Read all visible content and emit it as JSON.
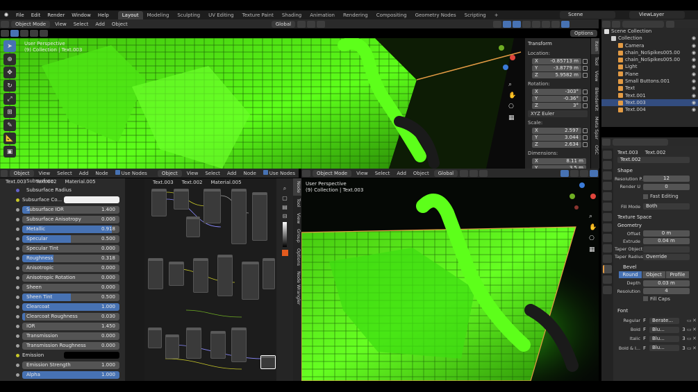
{
  "menubar": {
    "menus": [
      "File",
      "Edit",
      "Render",
      "Window",
      "Help"
    ],
    "workspaces": [
      "Layout",
      "Modeling",
      "Sculpting",
      "UV Editing",
      "Texture Paint",
      "Shading",
      "Animation",
      "Rendering",
      "Compositing",
      "Geometry Nodes",
      "Scripting"
    ],
    "active_workspace": "Layout",
    "add_tab": "+",
    "scene": "Scene",
    "view_layer": "ViewLayer"
  },
  "viewport_top": {
    "mode": "Object Mode",
    "menus": [
      "View",
      "Select",
      "Add",
      "Object"
    ],
    "orientation": "Global",
    "options": "Options",
    "overlay_title": "User Perspective",
    "overlay_sub": "(9) Collection | Text.003"
  },
  "npanel": {
    "title": "Transform",
    "location_label": "Location:",
    "location": [
      {
        "axis": "X",
        "value": "-0.85713 m"
      },
      {
        "axis": "Y",
        "value": "-3.8779 m"
      },
      {
        "axis": "Z",
        "value": "5.9582 m"
      }
    ],
    "rotation_label": "Rotation:",
    "rotation": [
      {
        "axis": "X",
        "value": "-303°"
      },
      {
        "axis": "Y",
        "value": "-0.36°"
      },
      {
        "axis": "Z",
        "value": "3°"
      }
    ],
    "euler": "XYZ Euler",
    "scale_label": "Scale:",
    "scale": [
      {
        "axis": "X",
        "value": "2.597"
      },
      {
        "axis": "Y",
        "value": "3.044"
      },
      {
        "axis": "Z",
        "value": "2.634"
      }
    ],
    "dimensions_label": "Dimensions:",
    "dimensions": [
      {
        "axis": "X",
        "value": "8.11 m"
      },
      {
        "axis": "Y",
        "value": "3.5 m"
      }
    ],
    "tabs": [
      "Item",
      "Tool",
      "View",
      "BlenderKit",
      "Meta Spar",
      "OSC"
    ]
  },
  "outliner": {
    "root": "Scene Collection",
    "items": [
      {
        "name": "Collection",
        "color": "#cfcfcf",
        "selected": false,
        "indent": 1
      },
      {
        "name": "Camera",
        "color": "#e39b44",
        "selected": false,
        "indent": 2
      },
      {
        "name": "chain_NoSpikes005.00",
        "color": "#e39b44",
        "selected": false,
        "indent": 2
      },
      {
        "name": "chain_NoSpikes005.00",
        "color": "#e39b44",
        "selected": false,
        "indent": 2
      },
      {
        "name": "Light",
        "color": "#e39b44",
        "selected": false,
        "indent": 2
      },
      {
        "name": "Plane",
        "color": "#e39b44",
        "selected": false,
        "indent": 2
      },
      {
        "name": "Small Buttons.001",
        "color": "#e39b44",
        "selected": false,
        "indent": 2
      },
      {
        "name": "Text",
        "color": "#e39b44",
        "selected": false,
        "indent": 2
      },
      {
        "name": "Text.001",
        "color": "#e39b44",
        "selected": false,
        "indent": 2
      },
      {
        "name": "Text.003",
        "color": "#e39b44",
        "selected": true,
        "indent": 2
      },
      {
        "name": "Text.004",
        "color": "#e39b44",
        "selected": false,
        "indent": 2
      }
    ]
  },
  "props": {
    "crumb_a": "Text.003",
    "crumb_b": "Text.002",
    "datablock": "Text.002",
    "shape": "Shape",
    "resolution_preview_label": "Resolution P...",
    "resolution_preview": "12",
    "render_u_label": "Render U",
    "render_u": "0",
    "fast_editing": "Fast Editing",
    "fill_mode_label": "Fill Mode",
    "fill_mode": "Both",
    "texture_space": "Texture Space",
    "geometry": "Geometry",
    "offset_label": "Offset",
    "offset": "0 m",
    "extrude_label": "Extrude",
    "extrude": "0.04 m",
    "taper_object_label": "Taper Object",
    "taper_radius_label": "Taper Radius",
    "taper_radius": "Override",
    "bevel": "Bevel",
    "bevel_modes": [
      "Round",
      "Object",
      "Profile"
    ],
    "depth_label": "Depth",
    "depth": "0.03 m",
    "resolution_label": "Resolution",
    "resolution": "4",
    "fill_caps": "Fill Caps",
    "font": "Font",
    "fonts": [
      {
        "label": "Regular",
        "name": "Berate...",
        "users": ""
      },
      {
        "label": "Bold",
        "name": "Blu...",
        "users": "3"
      },
      {
        "label": "Italic",
        "name": "Blu...",
        "users": "3"
      },
      {
        "label": "Bold & I...",
        "name": "Blu...",
        "users": "3"
      }
    ]
  },
  "shader_header": {
    "mode": "Object",
    "menus": [
      "View",
      "Select",
      "Add",
      "Node"
    ],
    "use_nodes": "Use Nodes",
    "crumbs": [
      "Text.003",
      "Text.002",
      "Material.005"
    ]
  },
  "material": {
    "top_label": "Subsurface",
    "rows": [
      {
        "label": "Subsurface Radius",
        "value": "",
        "fill": 0,
        "kind": "plain",
        "dot": "b"
      },
      {
        "label": "Subsurface Co...",
        "value": "",
        "fill": 0,
        "kind": "color",
        "dot": "y"
      },
      {
        "label": "Subsurface IOR",
        "value": "1.400",
        "fill": 0.08,
        "kind": "bar",
        "dot": "g"
      },
      {
        "label": "Subsurface Anisotropy",
        "value": "0.000",
        "fill": 0,
        "kind": "bar",
        "dot": "g"
      },
      {
        "label": "Metallic",
        "value": "0.918",
        "fill": 0.918,
        "kind": "bar",
        "dot": "g"
      },
      {
        "label": "Specular",
        "value": "0.500",
        "fill": 0.5,
        "kind": "bar",
        "dot": "g"
      },
      {
        "label": "Specular Tint",
        "value": "0.000",
        "fill": 0,
        "kind": "bar",
        "dot": "g"
      },
      {
        "label": "Roughness",
        "value": "0.318",
        "fill": 0.318,
        "kind": "bar",
        "dot": "g"
      },
      {
        "label": "Anisotropic",
        "value": "0.000",
        "fill": 0,
        "kind": "bar",
        "dot": "g"
      },
      {
        "label": "Anisotropic Rotation",
        "value": "0.000",
        "fill": 0,
        "kind": "bar",
        "dot": "g"
      },
      {
        "label": "Sheen",
        "value": "0.000",
        "fill": 0,
        "kind": "bar",
        "dot": "g"
      },
      {
        "label": "Sheen Tint",
        "value": "0.500",
        "fill": 0.5,
        "kind": "bar",
        "dot": "g"
      },
      {
        "label": "Clearcoat",
        "value": "1.000",
        "fill": 1,
        "kind": "bar",
        "dot": "g"
      },
      {
        "label": "Clearcoat Roughness",
        "value": "0.030",
        "fill": 0.03,
        "kind": "bar",
        "dot": "g"
      },
      {
        "label": "IOR",
        "value": "1.450",
        "fill": 0,
        "kind": "bar",
        "dot": "g"
      },
      {
        "label": "Transmission",
        "value": "0.000",
        "fill": 0,
        "kind": "bar",
        "dot": "g"
      },
      {
        "label": "Transmission Roughness",
        "value": "0.000",
        "fill": 0,
        "kind": "bar",
        "dot": "g"
      },
      {
        "label": "Emission",
        "value": "",
        "fill": 0,
        "kind": "dark",
        "dot": "y"
      },
      {
        "label": "Emission Strength",
        "value": "1.000",
        "fill": 0,
        "kind": "bar",
        "dot": "g"
      },
      {
        "label": "Alpha",
        "value": "1.000",
        "fill": 1,
        "kind": "bar",
        "dot": "g"
      }
    ]
  },
  "node_editor": {
    "crumbs": [
      "Text.003",
      "Text.002",
      "Material.005"
    ],
    "side_tabs": [
      "Node",
      "Tool",
      "View",
      "Group",
      "Options",
      "Node Wrangler"
    ]
  },
  "viewport_bottom": {
    "mode": "Object Mode",
    "menus": [
      "View",
      "Select",
      "Add",
      "Object"
    ],
    "orientation": "Global",
    "overlay_title": "User Perspective",
    "overlay_sub": "(9) Collection | Text.003"
  },
  "colors": {
    "accent": "#4772b3",
    "selected_orange": "#e39b44",
    "neon": "#5dff1a"
  }
}
